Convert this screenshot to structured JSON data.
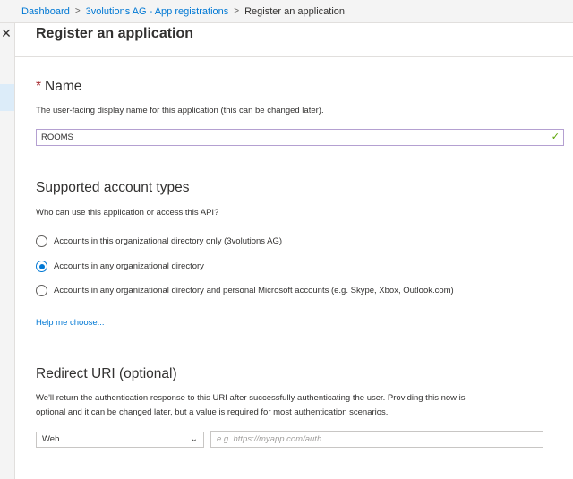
{
  "breadcrumb": {
    "items": [
      "Dashboard",
      "3volutions AG - App registrations"
    ],
    "current": "Register an application",
    "separator": ">"
  },
  "close_glyph": "✕",
  "page_title": "Register an application",
  "name_section": {
    "required_marker": "*",
    "heading": "Name",
    "helper": "The user-facing display name for this application (this can be changed later).",
    "value": "ROOMS",
    "valid_icon": "✓"
  },
  "account_types": {
    "heading": "Supported account types",
    "question": "Who can use this application or access this API?",
    "options": [
      {
        "label": "Accounts in this organizational directory only (3volutions AG)",
        "selected": false
      },
      {
        "label": "Accounts in any organizational directory",
        "selected": true
      },
      {
        "label": "Accounts in any organizational directory and personal Microsoft accounts (e.g. Skype, Xbox, Outlook.com)",
        "selected": false
      }
    ],
    "help_link": "Help me choose..."
  },
  "redirect": {
    "heading": "Redirect URI (optional)",
    "helper_line1": "We'll return the authentication response to this URI after successfully authenticating the user. Providing this now is",
    "helper_line2": "optional and it can be changed later, but a value is required for most authentication scenarios.",
    "platform_value": "Web",
    "chevron_glyph": "⌄",
    "uri_placeholder": "e.g. https://myapp.com/auth"
  },
  "colors": {
    "accent": "#0078d4",
    "required": "#a4262c",
    "valid": "#57a300"
  }
}
